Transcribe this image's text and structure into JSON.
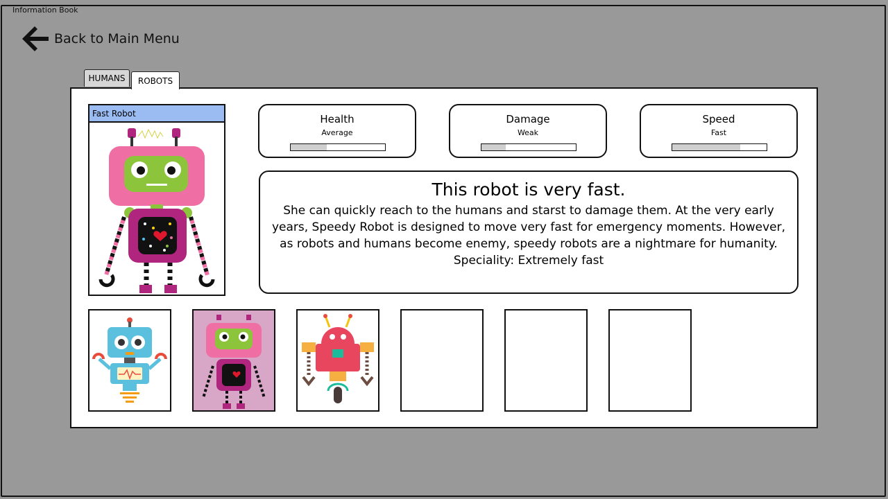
{
  "window": {
    "title": "Information Book"
  },
  "nav": {
    "back_label": "Back to Main Menu"
  },
  "tabs": [
    {
      "label": "HUMANS",
      "selected": false
    },
    {
      "label": "ROBOTS",
      "selected": true
    }
  ],
  "selected_robot": {
    "name": "Fast Robot",
    "stats": [
      {
        "name": "Health",
        "value": "Average",
        "level": 0.38
      },
      {
        "name": "Damage",
        "value": "Weak",
        "level": 0.26
      },
      {
        "name": "Speed",
        "value": "Fast",
        "level": 0.72
      }
    ],
    "headline": "This robot is very fast.",
    "description": "She can quickly reach to the humans and starst to damage them. At the very early years, Speedy Robot is designed to move very fast for emergency moments. However, as robots and humans become enemy, speedy robots are a nightmare for humanity.",
    "speciality": "Speciality: Extremely fast"
  },
  "robot_slots": [
    {
      "robot": "blue-robot",
      "selected": false
    },
    {
      "robot": "pink-robot",
      "selected": true
    },
    {
      "robot": "red-robot",
      "selected": false
    },
    {
      "robot": "empty",
      "selected": false
    },
    {
      "robot": "empty",
      "selected": false
    },
    {
      "robot": "empty",
      "selected": false
    }
  ],
  "colors": {
    "background": "#999999",
    "portrait_header": "#9bbcf2",
    "selected_slot": "#d8a6c6",
    "bar_fill": "#cfcfcf"
  }
}
